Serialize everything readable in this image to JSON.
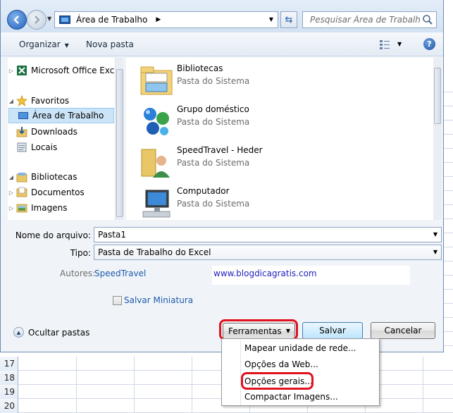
{
  "excel": {
    "rows": [
      "17",
      "18",
      "19",
      "20"
    ]
  },
  "navbar": {
    "address": "Área de Trabalho",
    "search_placeholder": "Pesquisar Área de Trabalho"
  },
  "toolbar": {
    "organize": "Organizar",
    "new_folder": "Nova pasta",
    "help": "?"
  },
  "sidebar": {
    "items": [
      {
        "label": "Microsoft Office Exce",
        "icon": "excel-icon"
      },
      {
        "label": "Favoritos",
        "icon": "star-icon"
      },
      {
        "label": "Área de Trabalho",
        "icon": "desktop-icon",
        "selected": true
      },
      {
        "label": "Downloads",
        "icon": "downloads-icon"
      },
      {
        "label": "Locais",
        "icon": "recent-places-icon"
      },
      {
        "label": "Bibliotecas",
        "icon": "libraries-icon"
      },
      {
        "label": "Documentos",
        "icon": "documents-icon"
      },
      {
        "label": "Imagens",
        "icon": "pictures-icon"
      }
    ]
  },
  "content": {
    "items": [
      {
        "name": "Bibliotecas",
        "desc": "Pasta do Sistema",
        "icon": "libraries-folder-icon"
      },
      {
        "name": "Grupo doméstico",
        "desc": "Pasta do Sistema",
        "icon": "homegroup-icon"
      },
      {
        "name": "SpeedTravel - Heder",
        "desc": "Pasta do Sistema",
        "icon": "user-folder-icon"
      },
      {
        "name": "Computador",
        "desc": "Pasta do Sistema",
        "icon": "computer-icon"
      }
    ]
  },
  "form": {
    "filename_label": "Nome do arquivo:",
    "filename_value": "Pasta1",
    "type_label": "Tipo:",
    "type_value": "Pasta de Trabalho do Excel",
    "authors_label": "Autores:",
    "authors_value": "SpeedTravel",
    "watermark": "www.blogdicagratis.com",
    "thumbnail_label": "Salvar Miniatura"
  },
  "footer": {
    "hide_folders": "Ocultar pastas",
    "tools": "Ferramentas",
    "save": "Salvar",
    "cancel": "Cancelar"
  },
  "tools_menu": {
    "items": [
      "Mapear unidade de rede...",
      "Opções da Web...",
      "Opções gerais...",
      "Compactar Imagens..."
    ]
  },
  "colors": {
    "highlight": "#e0121e",
    "link": "#1e5aa8",
    "selection": "#cce4f7"
  }
}
